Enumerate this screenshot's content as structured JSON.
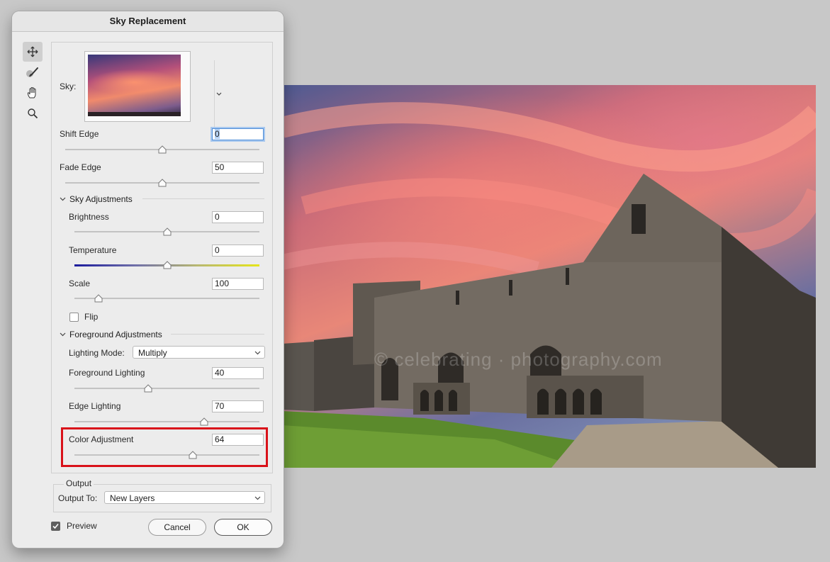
{
  "dialog": {
    "title": "Sky Replacement",
    "tools": [
      {
        "name": "move-sky-icon",
        "active": true
      },
      {
        "name": "sky-brush-icon",
        "active": false
      },
      {
        "name": "hand-icon",
        "active": false
      },
      {
        "name": "zoom-icon",
        "active": false
      }
    ],
    "sky_label": "Sky:",
    "shift_edge": {
      "label": "Shift Edge",
      "value": "0",
      "slider_fraction": 0.5
    },
    "fade_edge": {
      "label": "Fade Edge",
      "value": "50",
      "slider_fraction": 0.5
    },
    "sky_adjustments": {
      "label": "Sky Adjustments",
      "brightness": {
        "label": "Brightness",
        "value": "0",
        "slider_fraction": 0.5
      },
      "temperature": {
        "label": "Temperature",
        "value": "0",
        "slider_fraction": 0.5
      },
      "scale": {
        "label": "Scale",
        "value": "100",
        "slider_fraction": 0.13
      },
      "flip": {
        "label": "Flip",
        "checked": false
      }
    },
    "foreground_adjustments": {
      "label": "Foreground Adjustments",
      "lighting_mode": {
        "label": "Lighting Mode:",
        "value": "Multiply"
      },
      "foreground_lighting": {
        "label": "Foreground Lighting",
        "value": "40",
        "slider_fraction": 0.4
      },
      "edge_lighting": {
        "label": "Edge Lighting",
        "value": "70",
        "slider_fraction": 0.7
      },
      "color_adjustment": {
        "label": "Color Adjustment",
        "value": "64",
        "slider_fraction": 0.64
      }
    },
    "output": {
      "group_label": "Output",
      "output_to_label": "Output To:",
      "output_to_value": "New Layers"
    },
    "preview": {
      "label": "Preview",
      "checked": true
    },
    "cancel_label": "Cancel",
    "ok_label": "OK"
  },
  "photo": {
    "watermark": "© celebrating · photography.com"
  },
  "colors": {
    "highlight": "#d9121a",
    "focus": "#4f8ed8"
  }
}
